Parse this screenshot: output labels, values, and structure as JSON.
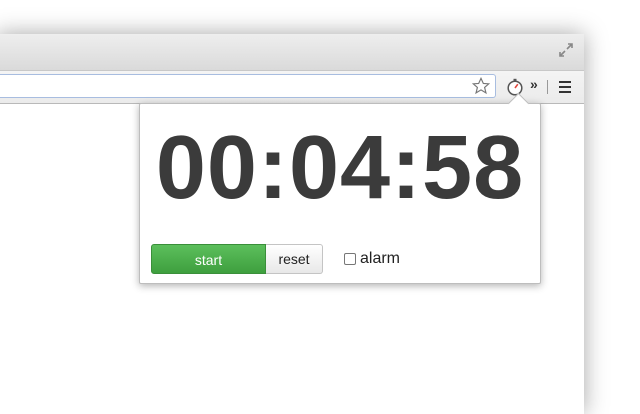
{
  "browser": {
    "icons": {
      "resize": "resize-arrows-icon",
      "bookmark": "star-icon",
      "extension": "stopwatch-icon",
      "overflow": "double-chevron-icon",
      "menu": "hamburger-menu-icon"
    },
    "overflow_glyph": "»"
  },
  "popup": {
    "time": "00:04:58",
    "start_label": "start",
    "reset_label": "reset",
    "alarm_label": "alarm",
    "alarm_checked": false
  },
  "colors": {
    "start_green": "#4caf50",
    "timer_text": "#3b3b3b",
    "extension_accent": "#e0463c"
  }
}
